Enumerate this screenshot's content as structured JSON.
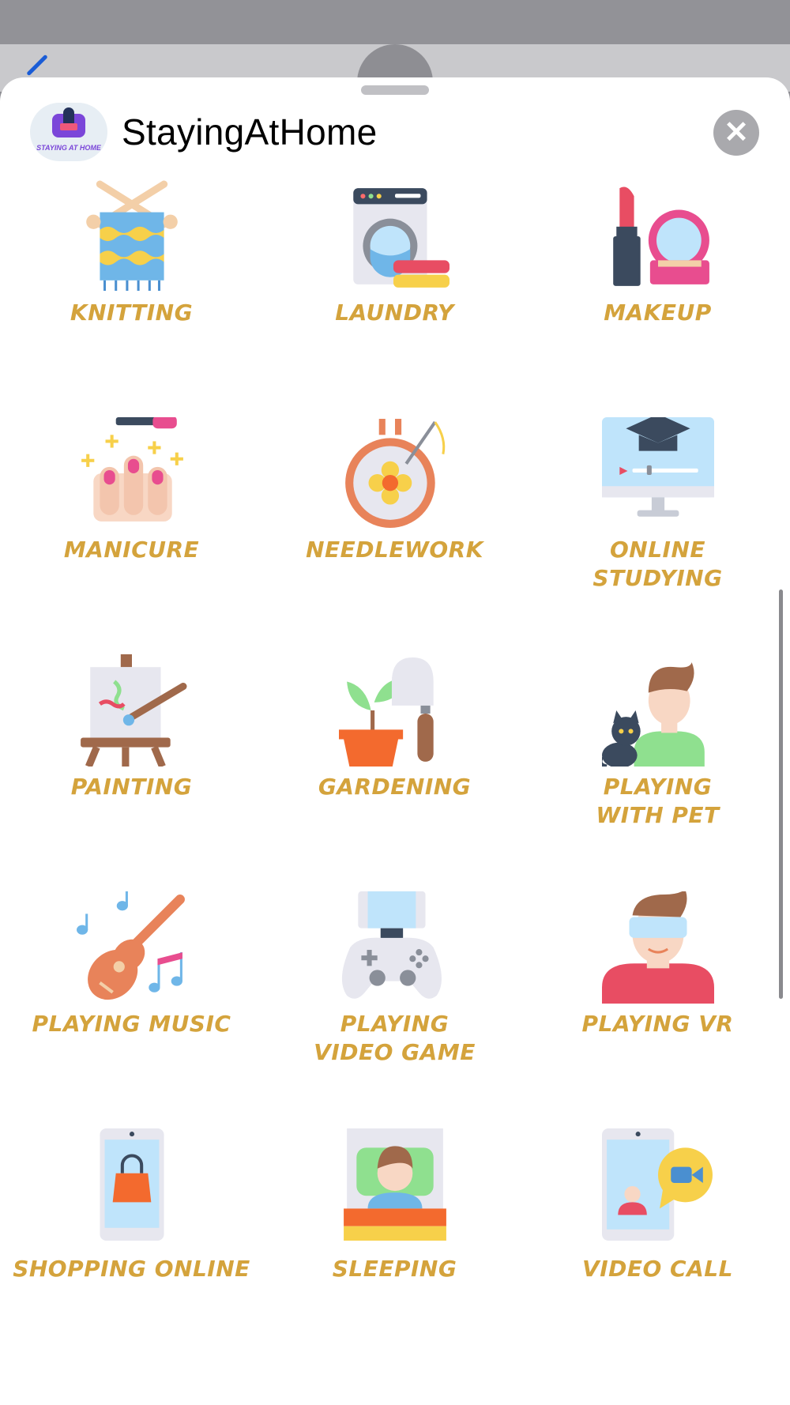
{
  "app": {
    "title": "StayingAtHome",
    "icon_caption": "STAYING AT HOME",
    "close_label": "✕"
  },
  "stickers": [
    {
      "label": "KNITTING",
      "icon": "knitting-icon"
    },
    {
      "label": "LAUNDRY",
      "icon": "laundry-icon"
    },
    {
      "label": "MAKEUP",
      "icon": "makeup-icon"
    },
    {
      "label": "MANICURE",
      "icon": "manicure-icon"
    },
    {
      "label": "NEEDLEWORK",
      "icon": "needlework-icon"
    },
    {
      "label": "ONLINE\nSTUDYING",
      "icon": "online-studying-icon"
    },
    {
      "label": "PAINTING",
      "icon": "painting-icon"
    },
    {
      "label": "GARDENING",
      "icon": "gardening-icon"
    },
    {
      "label": "PLAYING\nWITH PET",
      "icon": "playing-with-pet-icon"
    },
    {
      "label": "PLAYING MUSIC",
      "icon": "playing-music-icon"
    },
    {
      "label": "PLAYING\nVIDEO GAME",
      "icon": "playing-video-game-icon"
    },
    {
      "label": "PLAYING VR",
      "icon": "playing-vr-icon"
    },
    {
      "label": "SHOPPING ONLINE",
      "icon": "shopping-online-icon"
    },
    {
      "label": "SLEEPING",
      "icon": "sleeping-icon"
    },
    {
      "label": "VIDEO CALL",
      "icon": "video-call-icon"
    }
  ],
  "colors": {
    "label": "#d4a33c",
    "close_button": "#a9a9ad"
  }
}
